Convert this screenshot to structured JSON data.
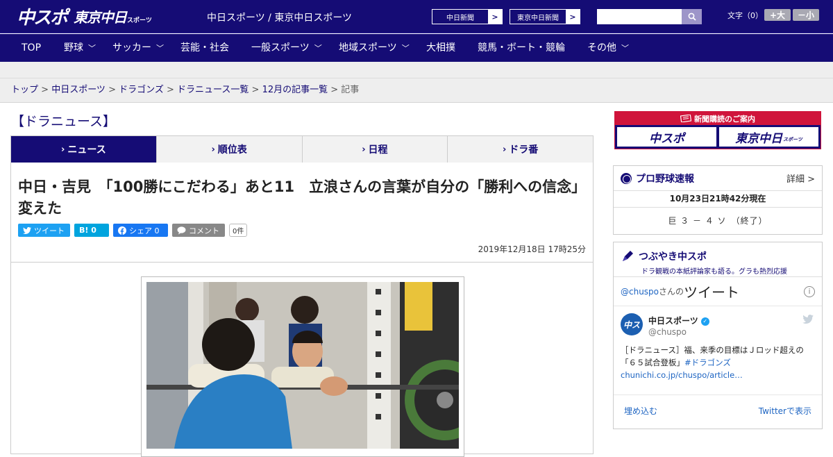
{
  "header": {
    "logo_main": "中スポ",
    "logo_sub": "東京中日",
    "logo_sub_small": "スポーツ",
    "site_title": "中日スポーツ / 東京中日スポーツ",
    "site_buttons": [
      "中日新聞",
      "東京中日新聞"
    ],
    "font_size_label": "文字（0）",
    "font_plus": "+大",
    "font_minus": "－小"
  },
  "nav": [
    "TOP",
    "野球",
    "サッカー",
    "芸能・社会",
    "一般スポーツ",
    "地域スポーツ",
    "大相撲",
    "競馬・ボート・競輪",
    "その他"
  ],
  "breadcrumb": [
    "トップ",
    "中日スポーツ",
    "ドラゴンズ",
    "ドラニュース一覧",
    "12月の記事一覧",
    "記事"
  ],
  "section_title": "【ドラニュース】",
  "tabs": [
    "ニュース",
    "順位表",
    "日程",
    "ドラ番"
  ],
  "article": {
    "headline": "中日・吉見　「100勝にこだわる」あと11　立浪さんの言葉が自分の「勝利への信念」変えた",
    "share": {
      "tweet": "ツイート",
      "hatena": "B! 0",
      "facebook": "シェア 0",
      "comment": "コメント",
      "count": "0件"
    },
    "date": "2019年12月18日 17時25分"
  },
  "sidebar": {
    "ad_title": "新聞購読のご案内",
    "ad_buttons": [
      "中スポ",
      "東京中日"
    ],
    "ad_button_small": "スポーツ",
    "baseball": {
      "title": "プロ野球速報",
      "more": "詳細 >",
      "updated": "10月23日21時42分現在",
      "score": "巨 ３ － ４ ソ　（終了）"
    },
    "tsubuyaki": {
      "title": "つぶやき中スポ",
      "subtitle": "ドラ観戦の本紙評論家も語る。グラも熱烈応援",
      "account": "@chuspo",
      "san": "さんの",
      "tweet_word": "ツイート",
      "info": "i",
      "tweet_name": "中日スポーツ",
      "tweet_handle": "@chuspo",
      "avatar_text": "中ス",
      "tweet_text": "［ドラニュース］福、来季の目標はＪロッド超えの「６５試合登板」",
      "tweet_hashtag": "#ドラゴンズ",
      "tweet_link": "chunichi.co.jp/chuspo/article…",
      "embed": "埋め込む",
      "view_twitter": "Twitterで表示"
    }
  },
  "colors": {
    "brand": "#150c75",
    "ad_red": "#d0143b",
    "twitter": "#1da1f2",
    "link": "#1d64c2"
  }
}
